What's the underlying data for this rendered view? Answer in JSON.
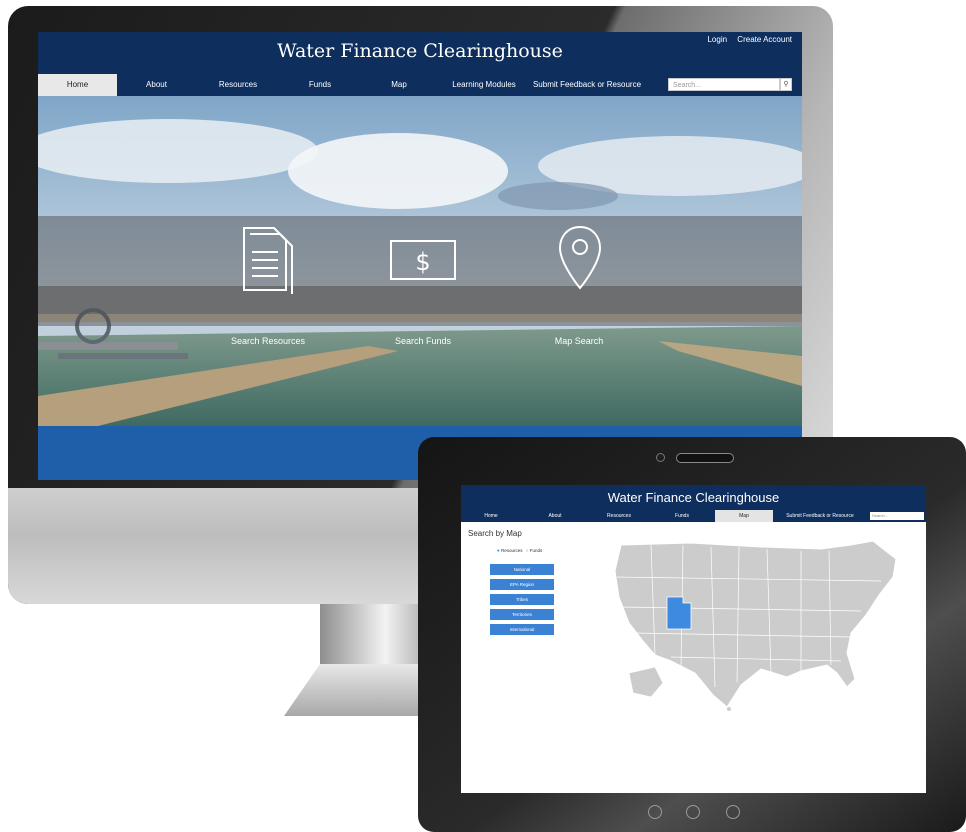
{
  "desktop": {
    "site_title": "Water Finance Clearinghouse",
    "top_links": [
      "Login",
      "Create Account"
    ],
    "nav": [
      "Home",
      "About",
      "Resources",
      "Funds",
      "Map",
      "Learning Modules",
      "Submit Feedback or Resource"
    ],
    "active_nav": "Home",
    "search_placeholder": "Search...",
    "hero_links": [
      "Search Resources",
      "Search Funds",
      "Map Search"
    ]
  },
  "tablet": {
    "site_title": "Water Finance Clearinghouse",
    "nav": [
      "Home",
      "About",
      "Resources",
      "Funds",
      "Map",
      "Submit Feedback or Resource"
    ],
    "active_nav": "Map",
    "search_placeholder": "Search...",
    "page_title": "Search by Map",
    "radio_options": [
      "Resources",
      "Funds"
    ],
    "selected_radio": "Resources",
    "region_buttons": [
      "National",
      "EPA Region",
      "Tribes",
      "Territories",
      "International"
    ],
    "highlighted_state": "Utah"
  },
  "colors": {
    "header_navy": "#0e2f5e",
    "accent_blue": "#1f5ea8",
    "button_blue": "#3b82d4",
    "map_gray": "#cccccc",
    "highlight_blue": "#3d8ae0"
  }
}
